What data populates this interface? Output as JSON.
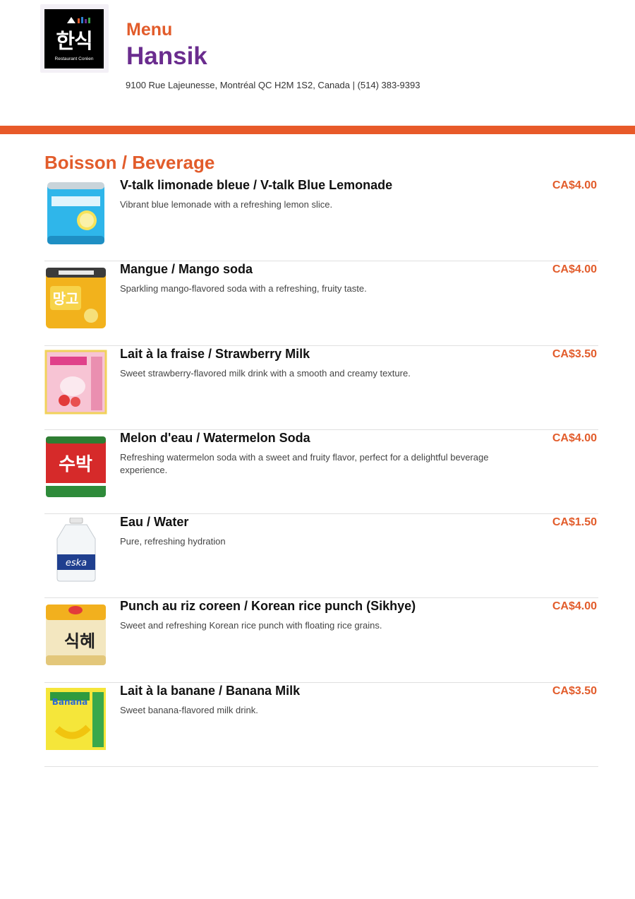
{
  "header": {
    "logo_hangul": "한식",
    "logo_subtitle": "Restaurant Coréen",
    "menu_label": "Menu",
    "restaurant_name": "Hansik",
    "address": "9100 Rue Lajeunesse, Montréal QC H2M 1S2, Canada | (514) 383-9393"
  },
  "colors": {
    "accent": "#e25c2b",
    "bar": "#e85a29",
    "brand": "#6a2c8e"
  },
  "section": {
    "title": "Boisson / Beverage"
  },
  "items": [
    {
      "name": "V-talk limonade bleue / V-talk Blue Lemonade",
      "description": "Vibrant blue lemonade with a refreshing lemon slice.",
      "price": "CA$4.00",
      "image": "blue-lemonade-can"
    },
    {
      "name": "Mangue / Mango soda",
      "description": "Sparkling mango-flavored soda with a refreshing, fruity taste.",
      "price": "CA$4.00",
      "image": "mango-soda-can"
    },
    {
      "name": "Lait à la fraise / Strawberry Milk",
      "description": "Sweet strawberry-flavored milk drink with a smooth and creamy texture.",
      "price": "CA$3.50",
      "image": "strawberry-milk-carton"
    },
    {
      "name": "Melon d'eau / Watermelon Soda",
      "description": "Refreshing watermelon soda with a sweet and fruity flavor, perfect for a delightful beverage experience.",
      "price": "CA$4.00",
      "image": "watermelon-soda-can"
    },
    {
      "name": "Eau / Water",
      "description": "Pure, refreshing hydration",
      "price": "CA$1.50",
      "image": "water-bottle"
    },
    {
      "name": "Punch au riz coreen  / Korean rice punch (Sikhye)",
      "description": "Sweet and refreshing Korean rice punch with floating rice grains.",
      "price": "CA$4.00",
      "image": "rice-punch-can"
    },
    {
      "name": "Lait à la banane / Banana Milk",
      "description": "Sweet banana-flavored milk drink.",
      "price": "CA$3.50",
      "image": "banana-milk-carton"
    }
  ]
}
